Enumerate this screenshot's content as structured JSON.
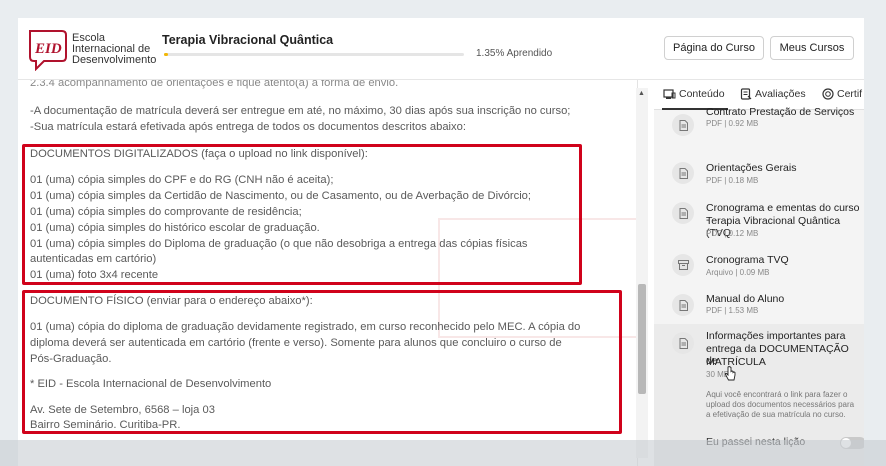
{
  "header": {
    "logo_mark": "EID",
    "logo_lines": [
      "Escola",
      "Internacional de",
      "Desenvolvimento"
    ],
    "course_title": "Terapia Vibracional Quântica",
    "progress_percent": 1.35,
    "progress_label": "1.35% Aprendido",
    "btn_course": "Página do Curso",
    "btn_mine": "Meus Cursos"
  },
  "doc": {
    "top_cut": "2.3.4 acompanhamento de orientações e fique atento(a) à forma de envio.",
    "lines_intro": [
      "-A documentação de matrícula deverá ser entregue em até, no máximo, 30 dias após sua inscrição no curso;",
      "-Sua matrícula estará efetivada após entrega de todos os documentos descritos abaixo:"
    ],
    "digital_title": "DOCUMENTOS DIGITALIZADOS (faça o upload no link disponível):",
    "digital_items": [
      "01 (uma) cópia simples do CPF e do RG (CNH não é aceita);",
      "01 (uma) cópia simples da Certidão de Nascimento, ou de Casamento, ou de Averbação de Divórcio;",
      "01 (uma) cópia simples do comprovante de residência;",
      "01 (uma) cópia simples do histórico escolar de graduação.",
      "01 (uma) cópia simples do Diploma de graduação (o que não desobriga a entrega das cópias físicas",
      "autenticadas em cartório)",
      "01 (uma) foto 3x4 recente"
    ],
    "physical_title": "DOCUMENTO FÍSICO (enviar para o endereço abaixo*):",
    "physical_items": [
      "01 (uma) cópia do diploma de graduação devidamente registrado, em curso reconhecido pelo MEC. A cópia do",
      "diploma deverá ser autenticada em cartório (frente e verso). Somente para alunos que concluiro o curso de",
      "Pós-Graduação."
    ],
    "address": [
      "* EID - Escola Internacional de Desenvolvimento",
      "Av. Sete de Setembro, 6568 – loja 03",
      "Bairro Seminário. Curitiba-PR."
    ]
  },
  "sidebar": {
    "tabs": [
      {
        "label": "Conteúdo",
        "icon": "content-icon"
      },
      {
        "label": "Avaliações",
        "icon": "assessment-icon"
      },
      {
        "label": "Certif",
        "icon": "certificate-icon"
      }
    ],
    "items": [
      {
        "title": "Contrato Prestação de Serviços",
        "meta": "PDF | 0.92 MB",
        "icon": "file-icon"
      },
      {
        "title": "Orientações Gerais",
        "meta": "PDF | 0.18 MB",
        "icon": "file-icon"
      },
      {
        "title": "Cronograma e ementas do curso - Terapia Vibracional Quântica (TVQ)",
        "title_l1": "Cronograma e ementas do curso -",
        "title_l2": "Terapia Vibracional Quântica (TVQ",
        "meta": "PDF | 0.12 MB",
        "icon": "file-icon"
      },
      {
        "title": "Cronograma TVQ",
        "meta": "Arquivo | 0.09 MB",
        "icon": "archive-icon"
      },
      {
        "title": "Manual do Aluno",
        "meta": "PDF | 1.53 MB",
        "icon": "file-icon"
      },
      {
        "title_l1": "Informações importantes para",
        "title_l2": "entrega da DOCUMENTAÇÃO de",
        "title_l3": "MATRÍCULA",
        "meta": "30 MB",
        "icon": "file-icon"
      }
    ],
    "desc_lines": [
      "Aqui você encontrará o link para fazer o",
      "upload dos documentos necessários para",
      "a efetivação de sua matrícula no curso."
    ],
    "passed_label": "Eu passei nesta lição"
  }
}
